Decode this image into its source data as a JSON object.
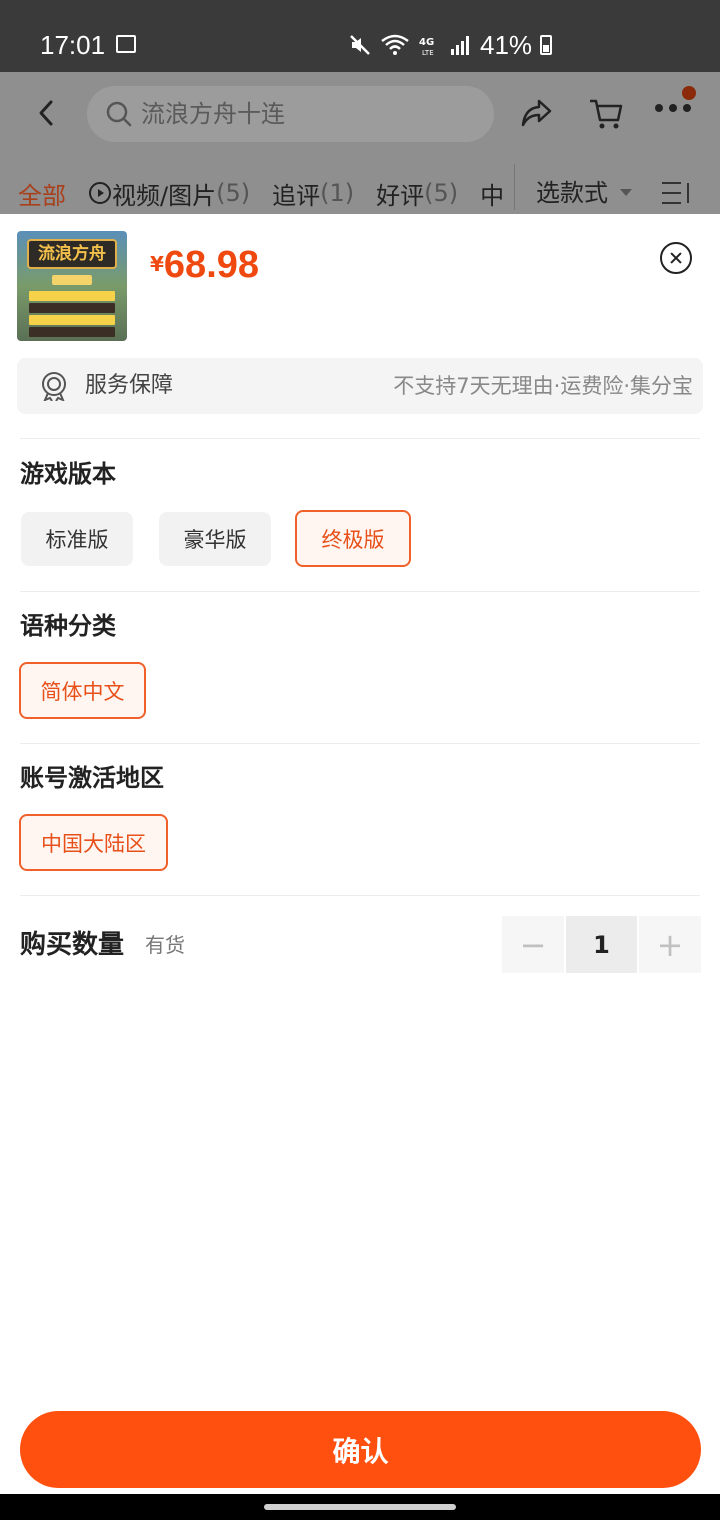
{
  "status_bar": {
    "time": "17:01",
    "battery": "41%",
    "icons": [
      "image-icon",
      "mute-icon",
      "wifi-icon",
      "4g-lte-icon",
      "signal-icon",
      "battery-icon"
    ]
  },
  "header": {
    "search_text": "流浪方舟十连",
    "icons": [
      "back-icon",
      "search-icon",
      "share-icon",
      "cart-icon",
      "more-icon"
    ]
  },
  "review_tabs": [
    {
      "label": "全部",
      "count": ""
    },
    {
      "label": "视频/图片",
      "count": "(5)"
    },
    {
      "label": "追评",
      "count": "(1)"
    },
    {
      "label": "好评",
      "count": "(5)"
    },
    {
      "label": "中",
      "count": ""
    }
  ],
  "select_style": "选款式",
  "product": {
    "image_title": "流浪方舟",
    "price_currency": "¥",
    "price": "68.98"
  },
  "service": {
    "label": "服务保障",
    "detail": "不支持7天无理由·运费险·集分宝"
  },
  "sections": [
    {
      "title": "游戏版本",
      "options": [
        "标准版",
        "豪华版",
        "终极版"
      ],
      "selected": "终极版"
    },
    {
      "title": "语种分类",
      "options": [
        "简体中文"
      ],
      "selected": "简体中文"
    },
    {
      "title": "账号激活地区",
      "options": [
        "中国大陆区"
      ],
      "selected": "中国大陆区"
    }
  ],
  "quantity": {
    "label": "购买数量",
    "stock": "有货",
    "value": "1",
    "minus": "−",
    "plus": "+"
  },
  "confirm_label": "确认",
  "colors": {
    "accent": "#ff5010",
    "price": "#f0490f",
    "selected_border": "#f0602a"
  }
}
